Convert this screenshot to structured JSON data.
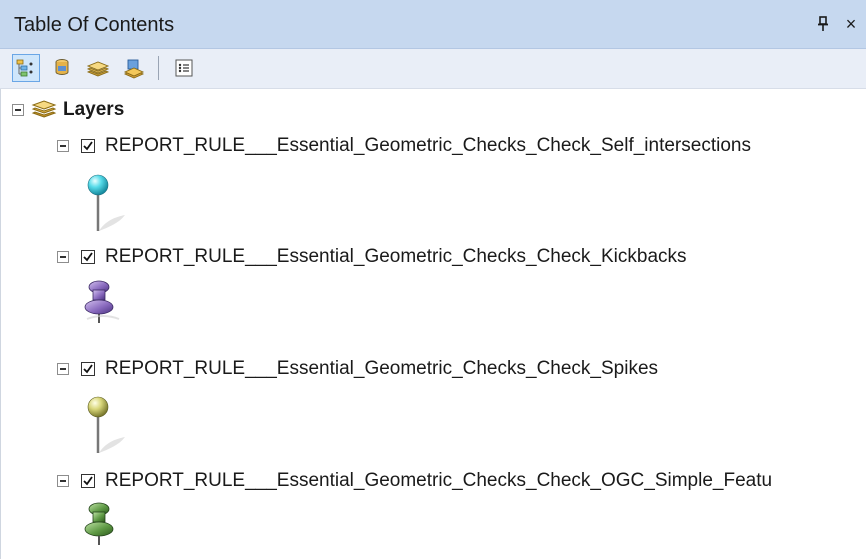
{
  "window": {
    "title": "Table Of Contents",
    "pin_glyph": "ꟸ",
    "close_glyph": "×"
  },
  "toolbar": {
    "buttons": [
      {
        "name": "list-by-drawing-order",
        "icon": "list-drawing-order-icon",
        "active": true
      },
      {
        "name": "list-by-source",
        "icon": "database-icon",
        "active": false
      },
      {
        "name": "list-by-visibility",
        "icon": "layers-stack-icon",
        "active": false
      },
      {
        "name": "list-by-selection",
        "icon": "selection-layer-icon",
        "active": false
      },
      {
        "name": "options",
        "icon": "options-list-icon",
        "active": false
      }
    ]
  },
  "tree": {
    "root": {
      "label": "Layers",
      "expanded": true
    },
    "layers": [
      {
        "label": "REPORT_RULE___Essential_Geometric_Checks_Check_Self_intersections",
        "checked": true,
        "symbol": "cyan-map-pin-icon",
        "color": "#4fd6e6"
      },
      {
        "label": "REPORT_RULE___Essential_Geometric_Checks_Check_Kickbacks",
        "checked": true,
        "symbol": "purple-push-pin-icon",
        "color": "#8a6bbf"
      },
      {
        "label": "REPORT_RULE___Essential_Geometric_Checks_Check_Spikes",
        "checked": true,
        "symbol": "yellow-map-pin-icon",
        "color": "#d8d67a"
      },
      {
        "label": "REPORT_RULE___Essential_Geometric_Checks_Check_OGC_Simple_Featu",
        "checked": true,
        "symbol": "green-push-pin-icon",
        "color": "#5f9a45"
      }
    ]
  },
  "colors": {
    "titlebar": "#c6d8ef",
    "toolbar": "#e9eef7",
    "active_button": "#cfe6fb"
  }
}
